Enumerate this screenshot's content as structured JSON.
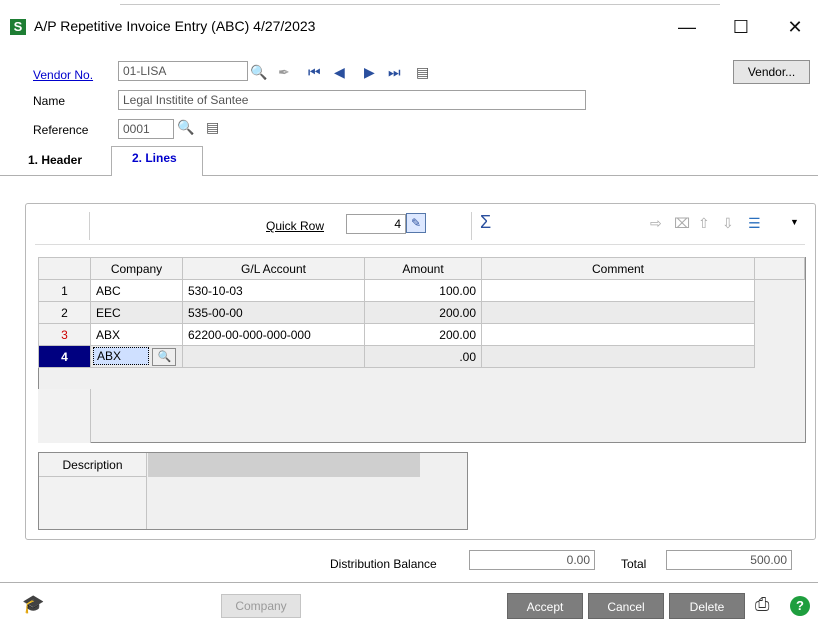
{
  "window": {
    "title": "A/P Repetitive Invoice Entry (ABC) 4/27/2023",
    "app_icon": "S"
  },
  "header": {
    "vendor_label": "Vendor No.",
    "vendor_value": "01-LISA",
    "name_label": "Name",
    "name_value": "Legal Institite of Santee",
    "reference_label": "Reference",
    "reference_value": "0001",
    "vendor_button": "Vendor..."
  },
  "tabs": [
    {
      "label": "1. Header"
    },
    {
      "label": "2. Lines"
    }
  ],
  "lines": {
    "quick_row_label": "Quick Row",
    "quick_row_value": "4",
    "columns": [
      "Company",
      "G/L Account",
      "Amount",
      "Comment"
    ],
    "rows": [
      {
        "num": "1",
        "company": "ABC",
        "account": "530-10-03",
        "amount": "100.00",
        "comment": ""
      },
      {
        "num": "2",
        "company": "EEC",
        "account": "535-00-00",
        "amount": "200.00",
        "comment": ""
      },
      {
        "num": "3",
        "company": "ABX",
        "account": "62200-00-000-000-000",
        "amount": "200.00",
        "comment": ""
      },
      {
        "num": "4",
        "company": "ABX",
        "account": "",
        "amount": ".00",
        "comment": ""
      }
    ],
    "description_label": "Description"
  },
  "totals": {
    "distribution_label": "Distribution Balance",
    "distribution_value": "0.00",
    "total_label": "Total",
    "total_value": "500.00"
  },
  "footer": {
    "company_button": "Company",
    "accept_button": "Accept",
    "cancel_button": "Cancel",
    "delete_button": "Delete"
  },
  "colors": {
    "accent": "#0000cc",
    "selected_row": "#000080",
    "row3_num": "#cc0000",
    "help": "#1e9e3e"
  }
}
